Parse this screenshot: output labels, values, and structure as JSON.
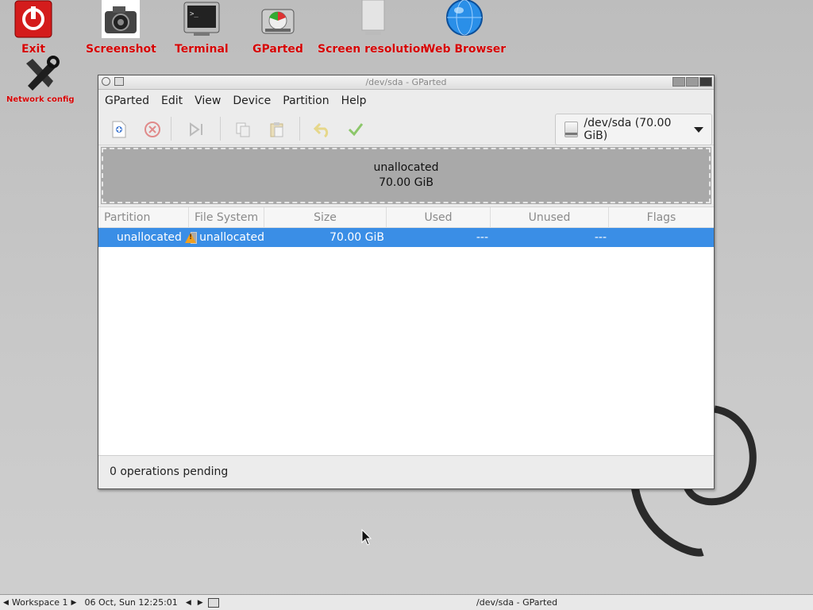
{
  "desktop": {
    "icons": [
      {
        "label": "Exit"
      },
      {
        "label": "Screenshot"
      },
      {
        "label": "Terminal"
      },
      {
        "label": "GParted"
      },
      {
        "label": "Screen resolution"
      },
      {
        "label": "Web Browser"
      },
      {
        "label": "Network config"
      }
    ]
  },
  "window": {
    "title": "/dev/sda - GParted",
    "menu": [
      "GParted",
      "Edit",
      "View",
      "Device",
      "Partition",
      "Help"
    ],
    "device_selector": "/dev/sda (70.00 GiB)",
    "graph": {
      "line1": "unallocated",
      "line2": "70.00 GiB"
    },
    "table": {
      "headers": [
        "Partition",
        "File System",
        "Size",
        "Used",
        "Unused",
        "Flags"
      ],
      "rows": [
        {
          "partition": "unallocated",
          "filesystem": "unallocated",
          "size": "70.00 GiB",
          "used": "---",
          "unused": "---",
          "flags": ""
        }
      ]
    },
    "status": "0 operations pending"
  },
  "taskbar": {
    "workspace": "Workspace 1",
    "datetime": "06 Oct, Sun 12:25:01",
    "task": "/dev/sda - GParted"
  },
  "colors": {
    "selection": "#3a8ee6",
    "desktop_label": "#d40000"
  }
}
